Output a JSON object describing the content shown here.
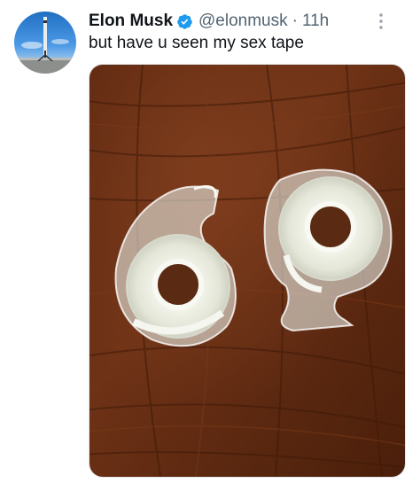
{
  "tweet": {
    "display_name": "Elon Musk",
    "handle": "@elonmusk",
    "separator": "·",
    "timestamp": "11h",
    "text": "but have u seen my sex tape",
    "verified": true
  },
  "avatar": {
    "icon": "rocket-launch-avatar"
  },
  "media": {
    "icon": "photo-two-tape-dispensers"
  },
  "colors": {
    "name": "#0f1419",
    "secondary": "#536471",
    "verified_badge": "#1d9bf0"
  }
}
